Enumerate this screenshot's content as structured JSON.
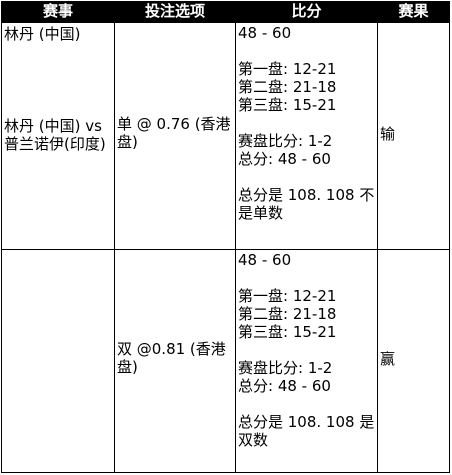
{
  "headers": {
    "event": "赛事",
    "bet_option": "投注选项",
    "score": "比分",
    "result": "赛果"
  },
  "rows": [
    {
      "tournament": "林丹 (中国)",
      "match": "林丹 (中国) vs 普兰诺伊(印度)",
      "bet": "单 @ 0.76 (香港盘)",
      "final_score": "48 - 60",
      "games": [
        "第一盘: 12-21",
        "第二盘: 21-18",
        "第三盘: 15-21"
      ],
      "set_score": "赛盘比分: 1-2",
      "total_score": "总分: 48 - 60",
      "total_note": "总分是 108. 108 不是单数",
      "result": "输"
    },
    {
      "tournament": "",
      "match": "",
      "bet": "双 @0.81 (香港盘)",
      "final_score": "48 - 60",
      "games": [
        "第一盘: 12-21",
        "第二盘: 21-18",
        "第三盘: 15-21"
      ],
      "set_score": "赛盘比分: 1-2",
      "total_score": "总分: 48 - 60",
      "total_note": "总分是 108. 108 是双数",
      "result": "赢"
    }
  ]
}
